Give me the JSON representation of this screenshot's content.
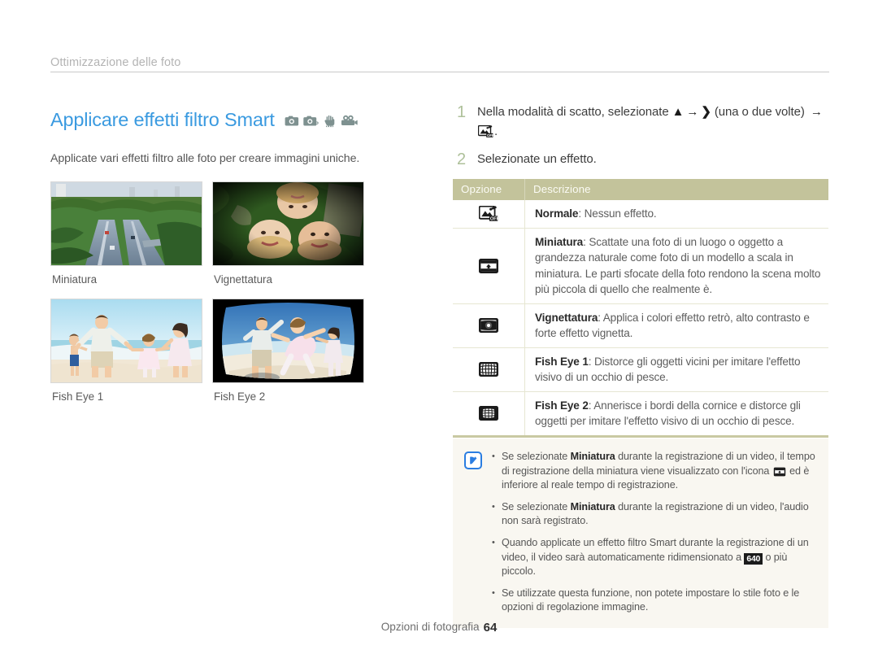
{
  "breadcrumb": {
    "label": "Ottimizzazione delle foto"
  },
  "page": {
    "title": "Applicare effetti filtro Smart",
    "subtitle": "Applicate vari effetti filtro alle foto per creare immagini uniche.",
    "title_color": "#3a9ae0",
    "mode_icons": [
      "camera-icon",
      "camera-program-icon",
      "dual-is-hand-icon",
      "camcorder-icon"
    ]
  },
  "samples": [
    {
      "label": "Miniatura",
      "icon": "thumbnail-sample-image"
    },
    {
      "label": "Vignettatura",
      "icon": "vignette-sample-image"
    },
    {
      "label": "Fish Eye 1",
      "icon": "fisheye1-sample-image"
    },
    {
      "label": "Fish Eye 2",
      "icon": "fisheye2-sample-image"
    }
  ],
  "steps": [
    {
      "num": "1",
      "pre": "Nella modalità di scatto, selezionate ",
      "glyph1": "▲",
      "arrow1": "→",
      "glyph2": "❯",
      "mid": " (una o due volte) ",
      "arrow2": "→",
      "end_icon": "smart-filter-off-icon",
      "post": "."
    },
    {
      "num": "2",
      "text": "Selezionate un effetto."
    }
  ],
  "table": {
    "headers": [
      "Opzione",
      "Descrizione"
    ],
    "header_bg": "#c3c39b",
    "rows": [
      {
        "icon": "smart-filter-off-icon",
        "name": "Normale",
        "desc": ": Nessun effetto."
      },
      {
        "icon": "miniature-icon",
        "name": "Miniatura",
        "desc": ": Scattate una foto di un luogo o oggetto a grandezza naturale come foto di un modello a scala in miniatura. Le parti sfocate della foto rendono la scena molto più piccola di quello che realmente è."
      },
      {
        "icon": "vignetting-icon",
        "name": "Vignettatura",
        "desc": ": Applica i colori effetto retrò, alto contrasto e forte effetto vignetta."
      },
      {
        "icon": "fisheye1-icon",
        "name": "Fish Eye 1",
        "desc": ": Distorce gli oggetti vicini per imitare l'effetto visivo di un occhio di pesce."
      },
      {
        "icon": "fisheye2-icon",
        "name": "Fish Eye 2",
        "desc": ": Annerisce i bordi della cornice e distorce gli oggetti per imitare l'effetto visivo di un occhio di pesce."
      }
    ]
  },
  "note": {
    "icon": "note-pen-icon",
    "items": [
      {
        "pre": "Se selezionate ",
        "bold": "Miniatura",
        "mid": " durante la registrazione di un video, il tempo di registrazione della miniatura viene visualizzato con l'icona ",
        "inline_icon": "miniature-icon",
        "post": " ed è inferiore al reale tempo di registrazione."
      },
      {
        "pre": "Se selezionate ",
        "bold": "Miniatura",
        "mid": " durante la registrazione di un video, l'audio non sarà registrato.",
        "post": ""
      },
      {
        "pre": "Quando applicate un effetto filtro Smart durante la registrazione di un video, il video sarà automaticamente ridimensionato a ",
        "badge": "640",
        "post": " o più piccolo."
      },
      {
        "pre": "Se utilizzate questa funzione, non potete impostare lo stile foto e le opzioni di regolazione immagine.",
        "post": ""
      }
    ]
  },
  "footer": {
    "label": "Opzioni di fotografia",
    "page_number": "64"
  }
}
